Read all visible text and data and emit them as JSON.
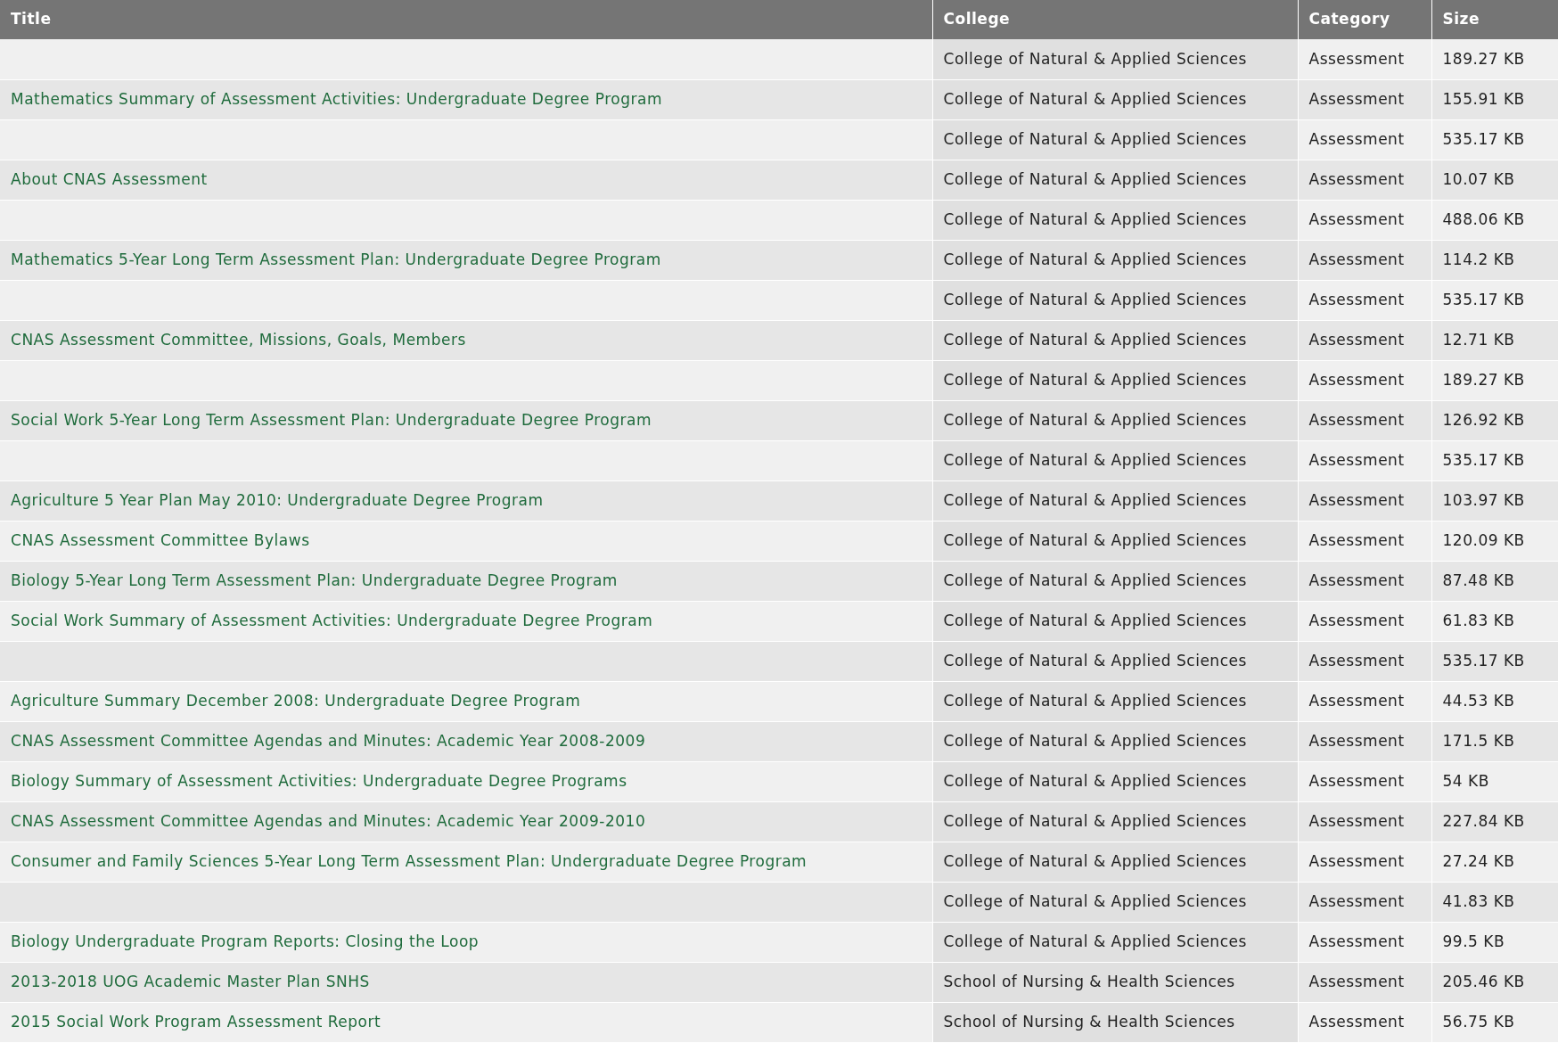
{
  "table": {
    "columns": [
      "Title",
      "College",
      "Category",
      "Size"
    ],
    "rows": [
      {
        "college": "College of Natural & Applied Sciences",
        "category": "Assessment",
        "size": "189.27 KB"
      },
      {
        "title": "Mathematics Summary of Assessment Activities: Undergraduate Degree Program",
        "college": "College of Natural & Applied Sciences",
        "category": "Assessment",
        "size": "155.91 KB"
      },
      {
        "college": "College of Natural & Applied Sciences",
        "category": "Assessment",
        "size": "535.17 KB"
      },
      {
        "title": "About CNAS Assessment",
        "college": "College of Natural & Applied Sciences",
        "category": "Assessment",
        "size": "10.07 KB"
      },
      {
        "college": "College of Natural & Applied Sciences",
        "category": "Assessment",
        "size": "488.06 KB"
      },
      {
        "title": "Mathematics 5-Year Long Term Assessment Plan: Undergraduate Degree Program",
        "college": "College of Natural & Applied Sciences",
        "category": "Assessment",
        "size": "114.2 KB"
      },
      {
        "college": "College of Natural & Applied Sciences",
        "category": "Assessment",
        "size": "535.17 KB"
      },
      {
        "title": "CNAS Assessment Committee, Missions, Goals, Members",
        "college": "College of Natural & Applied Sciences",
        "category": "Assessment",
        "size": "12.71 KB"
      },
      {
        "college": "College of Natural & Applied Sciences",
        "category": "Assessment",
        "size": "189.27 KB"
      },
      {
        "title": "Social Work 5-Year Long Term Assessment Plan: Undergraduate Degree Program",
        "college": "College of Natural & Applied Sciences",
        "category": "Assessment",
        "size": "126.92 KB"
      },
      {
        "college": "College of Natural & Applied Sciences",
        "category": "Assessment",
        "size": "535.17 KB"
      },
      {
        "title": "Agriculture 5 Year Plan May 2010: Undergraduate Degree Program",
        "college": "College of Natural & Applied Sciences",
        "category": "Assessment",
        "size": "103.97 KB"
      },
      {
        "title": "CNAS Assessment Committee Bylaws",
        "college": "College of Natural & Applied Sciences",
        "category": "Assessment",
        "size": "120.09 KB"
      },
      {
        "title": "Biology 5-Year Long Term Assessment Plan: Undergraduate Degree Program",
        "college": "College of Natural & Applied Sciences",
        "category": "Assessment",
        "size": "87.48 KB"
      },
      {
        "title": "Social Work Summary of Assessment Activities: Undergraduate Degree Program",
        "college": "College of Natural & Applied Sciences",
        "category": "Assessment",
        "size": "61.83 KB"
      },
      {
        "college": "College of Natural & Applied Sciences",
        "category": "Assessment",
        "size": "535.17 KB"
      },
      {
        "title": "Agriculture Summary December 2008: Undergraduate Degree Program",
        "college": "College of Natural & Applied Sciences",
        "category": "Assessment",
        "size": "44.53 KB"
      },
      {
        "title": "CNAS Assessment Committee Agendas and Minutes: Academic Year 2008-2009",
        "college": "College of Natural & Applied Sciences",
        "category": "Assessment",
        "size": "171.5 KB"
      },
      {
        "title": "Biology Summary of Assessment Activities: Undergraduate Degree Programs",
        "college": "College of Natural & Applied Sciences",
        "category": "Assessment",
        "size": "54 KB"
      },
      {
        "title": "CNAS Assessment Committee Agendas and Minutes: Academic Year 2009-2010",
        "college": "College of Natural & Applied Sciences",
        "category": "Assessment",
        "size": "227.84 KB"
      },
      {
        "title": "Consumer and Family Sciences 5-Year Long Term Assessment Plan: Undergraduate Degree Program",
        "college": "College of Natural & Applied Sciences",
        "category": "Assessment",
        "size": "27.24 KB"
      },
      {
        "college": "College of Natural & Applied Sciences",
        "category": "Assessment",
        "size": "41.83 KB"
      },
      {
        "title": "Biology Undergraduate Program Reports: Closing the Loop",
        "college": "College of Natural & Applied Sciences",
        "category": "Assessment",
        "size": "99.5 KB"
      },
      {
        "title": "2013-2018 UOG Academic Master Plan SNHS",
        "college": "School of Nursing & Health Sciences",
        "category": "Assessment",
        "size": "205.46 KB"
      },
      {
        "title": "2015 Social Work Program Assessment Report",
        "college": "School of Nursing & Health Sciences",
        "category": "Assessment",
        "size": "56.75 KB"
      }
    ]
  }
}
